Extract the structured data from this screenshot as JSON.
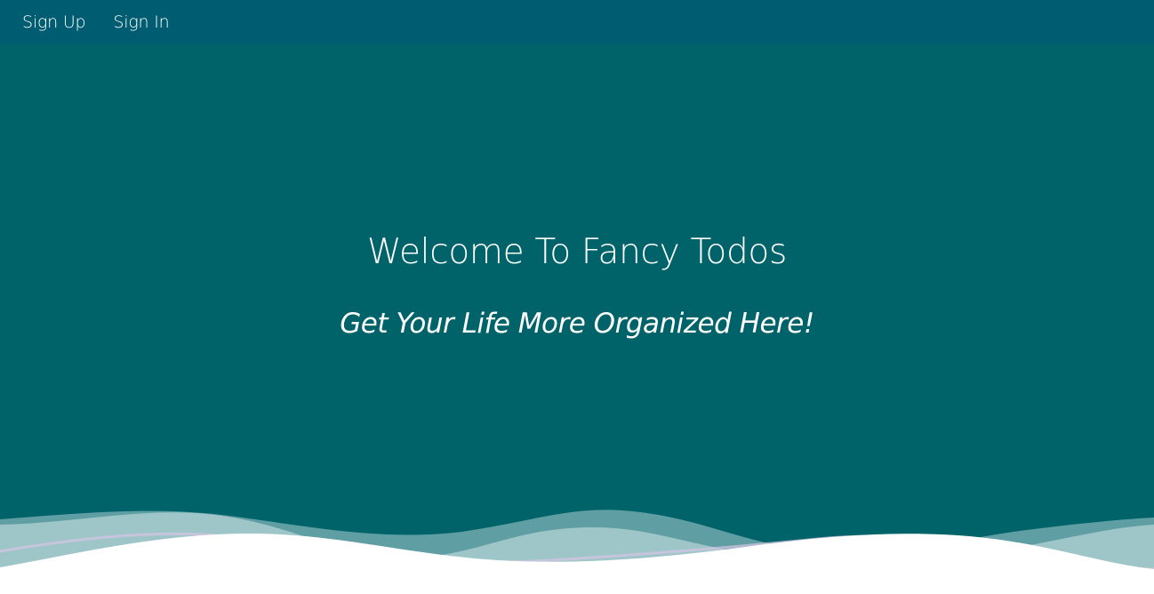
{
  "nav": {
    "signup_label": "Sign Up",
    "signin_label": "Sign In"
  },
  "hero": {
    "title": "Welcome To Fancy Todos",
    "subtitle": "Get Your Life More Organized Here!"
  },
  "colors": {
    "background": "#006369",
    "navbar": "#005c70",
    "text": "#ffffff",
    "wave_light": "#a9ccd0",
    "wave_white": "#ffffff"
  }
}
